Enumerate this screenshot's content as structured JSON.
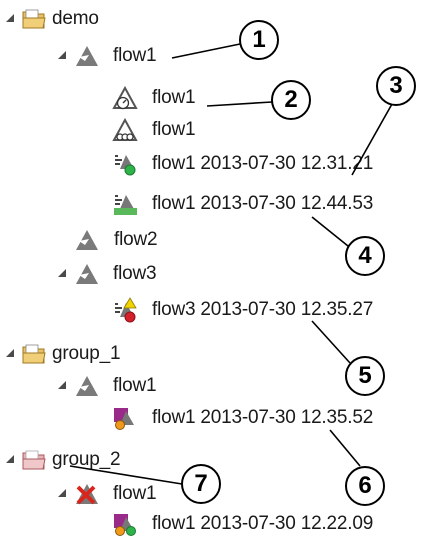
{
  "tree": {
    "rows": [
      {
        "label": "demo",
        "icon": "folder-icon"
      },
      {
        "label": "flow1",
        "icon": "flow-icon"
      },
      {
        "label": "flow1",
        "icon": "flow-timer-icon"
      },
      {
        "label": "flow1",
        "icon": "flow-sub-icon"
      },
      {
        "label": "flow1 2013-07-30 12.31.21",
        "icon": "run-success-icon"
      },
      {
        "label": "flow1 2013-07-30 12.44.53",
        "icon": "run-running-icon"
      },
      {
        "label": "flow2",
        "icon": "flow-icon"
      },
      {
        "label": "flow3",
        "icon": "flow-icon"
      },
      {
        "label": "flow3 2013-07-30 12.35.27",
        "icon": "run-warning-error-icon"
      },
      {
        "label": "group_1",
        "icon": "folder-icon"
      },
      {
        "label": "flow1",
        "icon": "flow-icon"
      },
      {
        "label": "flow1 2013-07-30 12.35.52",
        "icon": "run-stopped-icon"
      },
      {
        "label": "group_2",
        "icon": "folder-disabled-icon"
      },
      {
        "label": "flow1",
        "icon": "flow-deleted-icon"
      },
      {
        "label": "flow1 2013-07-30 12.22.09",
        "icon": "run-stopped-success-icon"
      }
    ]
  },
  "callouts": [
    "1",
    "2",
    "3",
    "4",
    "5",
    "6",
    "7"
  ],
  "colors": {
    "folder": "#e9c062",
    "folder_disabled": "#e8b3b6",
    "flow_gray": "#808080",
    "success_green": "#2db34a",
    "error_red": "#d3202b",
    "warning_yellow": "#f2d300",
    "running_green": "#58b85a",
    "delete_red": "#d9261c"
  }
}
